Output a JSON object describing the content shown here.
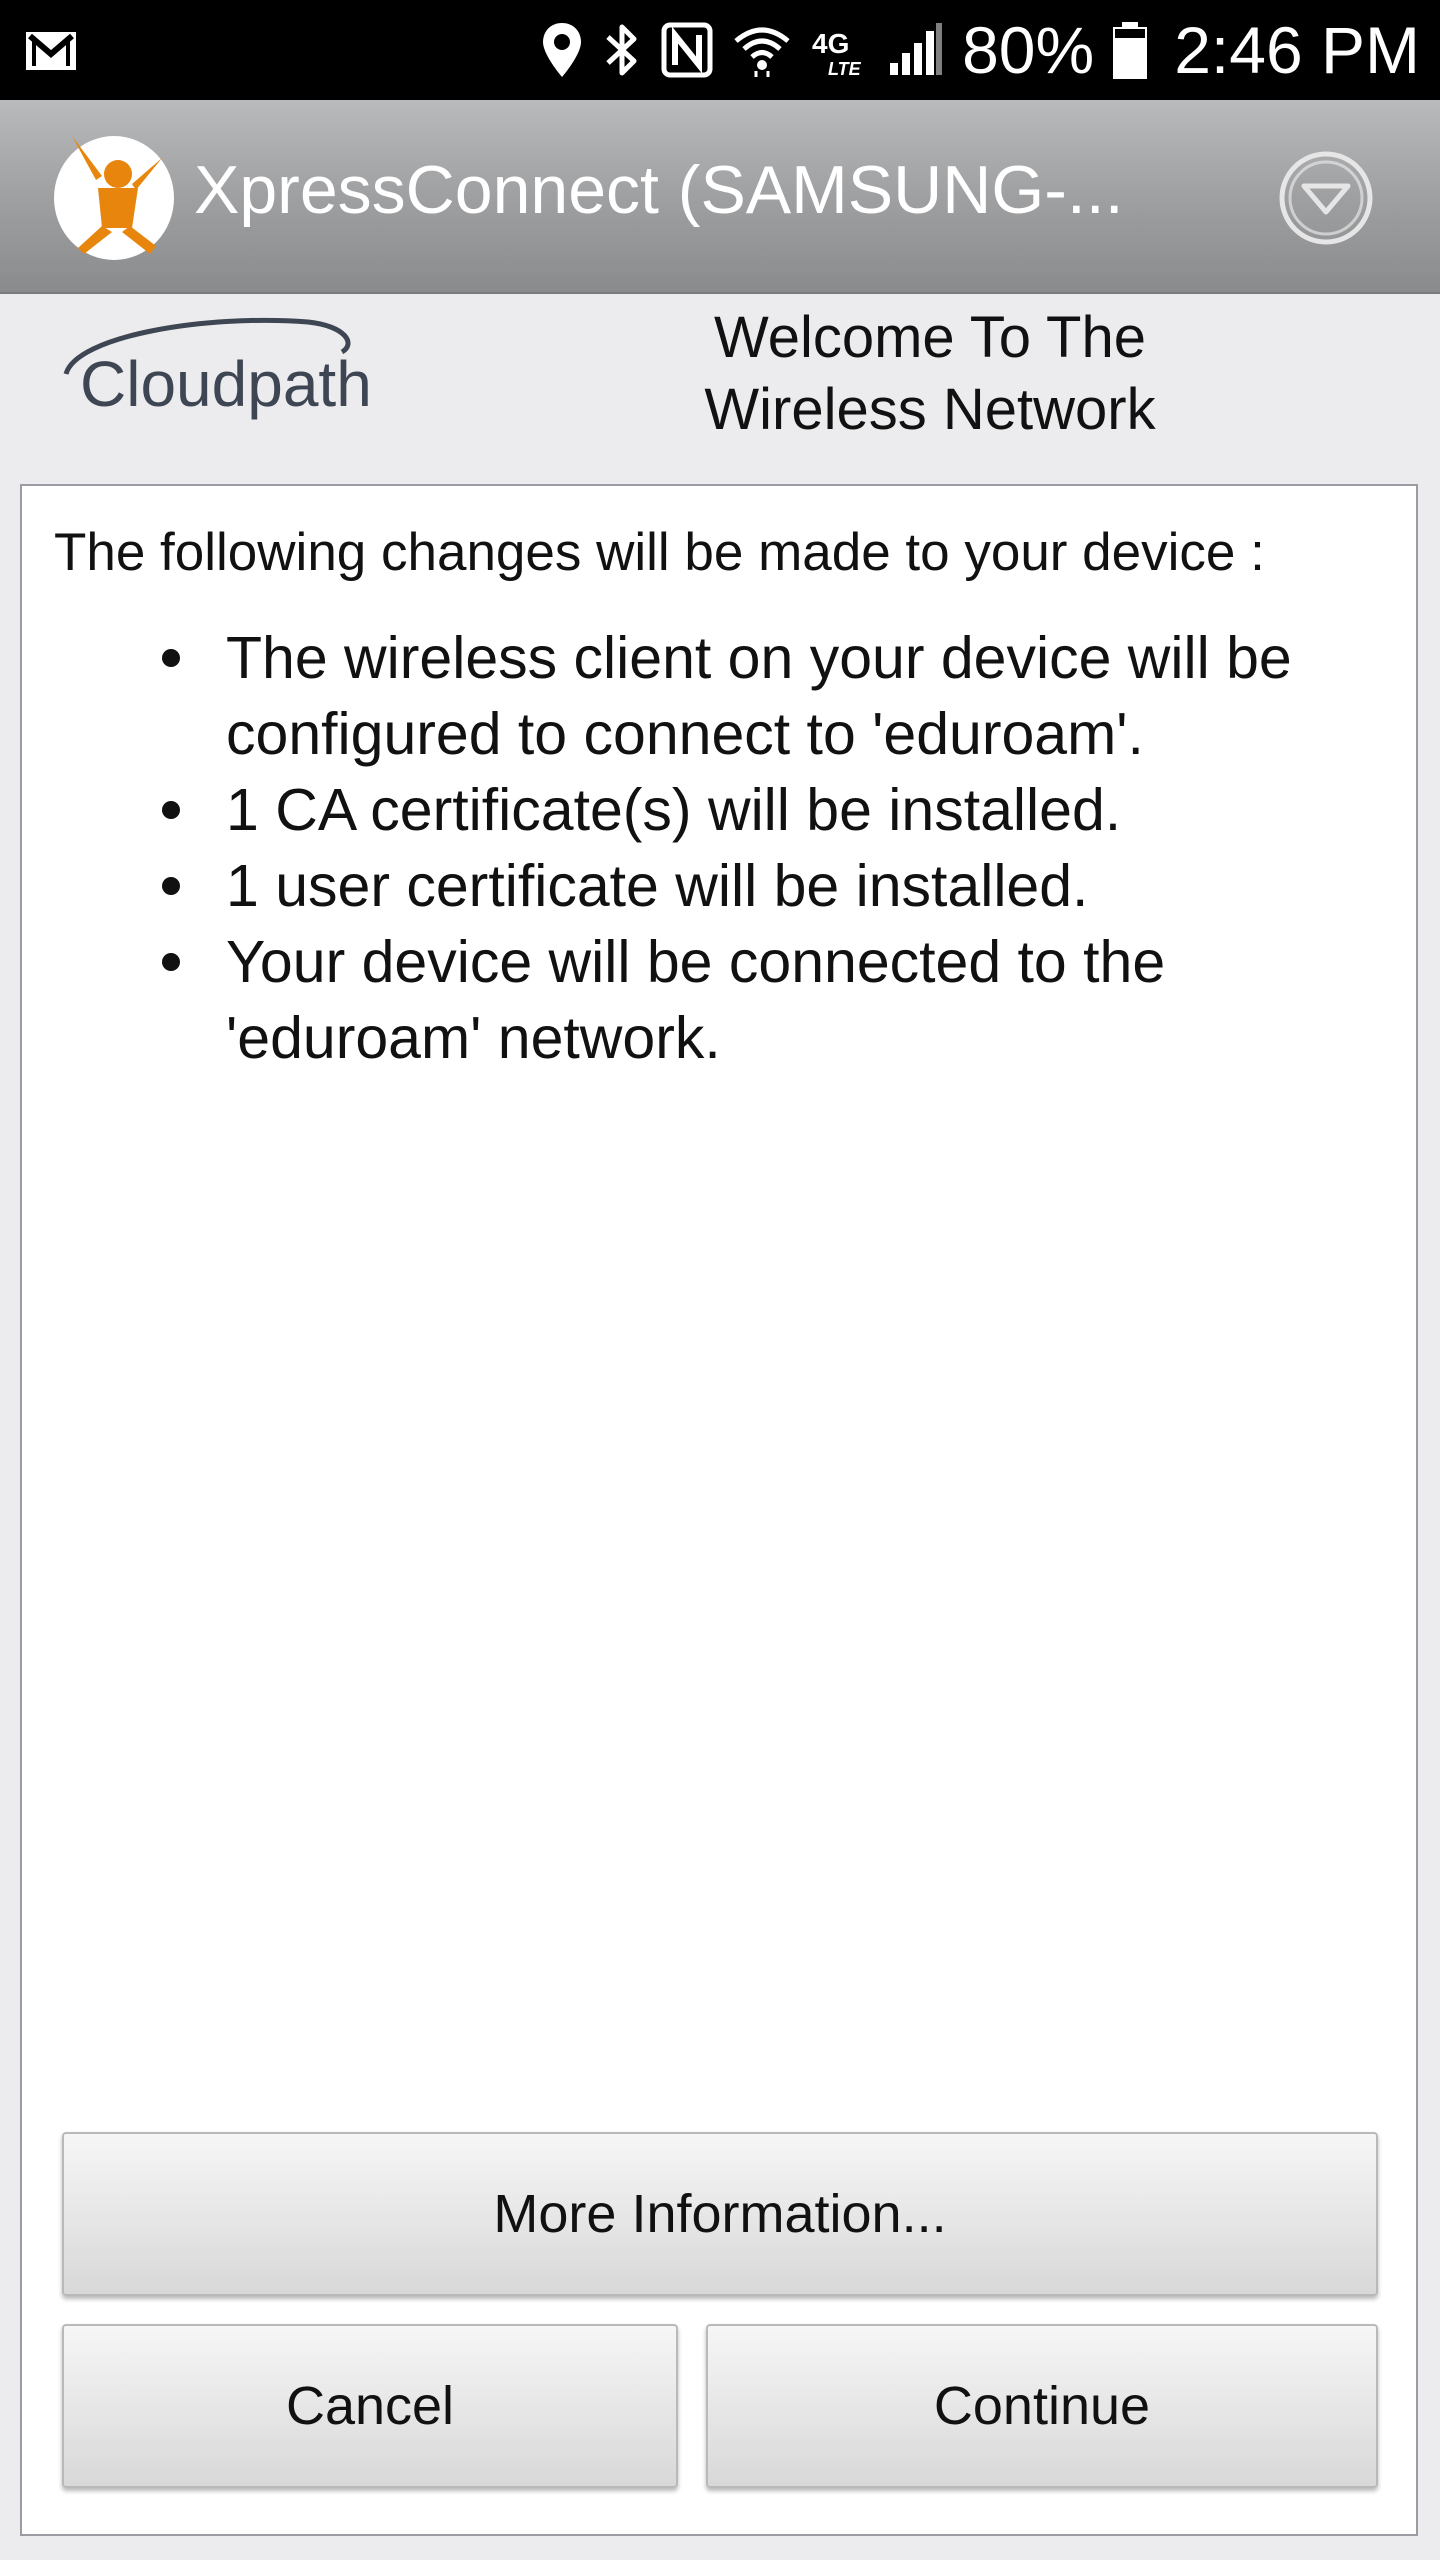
{
  "status_bar": {
    "icons": [
      "gmail-icon",
      "location-icon",
      "bluetooth-icon",
      "nfc-icon",
      "wifi-icon",
      "4g-lte-icon",
      "signal-icon",
      "battery-icon"
    ],
    "battery_text": "80%",
    "battery_level_percent": 80,
    "time": "2:46 PM"
  },
  "action_bar": {
    "title": "XpressConnect  (SAMSUNG-...",
    "logo_icon": "person-cheering-icon",
    "overflow_icon": "chevron-down-circle-icon"
  },
  "header": {
    "brand": "Cloudpath",
    "welcome_line1": "Welcome To The",
    "welcome_line2": "Wireless Network"
  },
  "content": {
    "intro": "The following changes will be made to your device :",
    "changes": [
      "The wireless client on your device will be configured to connect to 'eduroam'.",
      "1 CA certificate(s) will be installed.",
      "1 user certificate will be installed.",
      "Your device will be connected to the 'eduroam' network."
    ]
  },
  "buttons": {
    "more_info": "More Information...",
    "cancel": "Cancel",
    "continue": "Continue"
  },
  "colors": {
    "status_bar_bg": "#000000",
    "action_bar_bg": "#9fa0a2",
    "logo_accent": "#e8850c",
    "panel_bg": "#ffffff",
    "page_bg": "#ececee"
  }
}
